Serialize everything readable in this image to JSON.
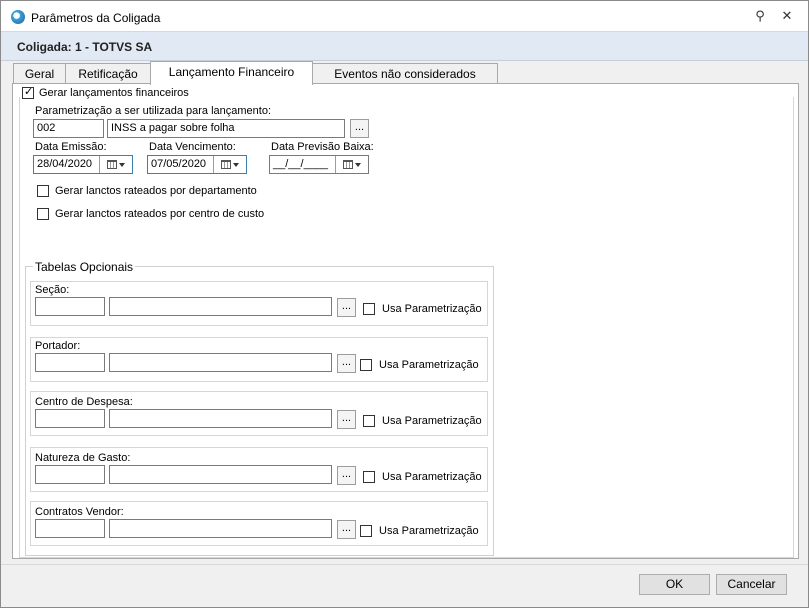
{
  "window": {
    "title": "Parâmetros da Coligada"
  },
  "header": {
    "context": "Coligada: 1 - TOTVS SA"
  },
  "tabs": [
    {
      "label": "Geral"
    },
    {
      "label": "Retificação"
    },
    {
      "label": "Lançamento Financeiro"
    },
    {
      "label": "Eventos não considerados"
    }
  ],
  "main": {
    "gerar_lancamentos": {
      "label": "Gerar lançamentos financeiros",
      "checked": true
    },
    "parametrizacao": {
      "label": "Parametrização a ser utilizada para lançamento:",
      "code": "002",
      "description": "INSS a pagar sobre folha",
      "lookup": "..."
    },
    "data_emissao": {
      "label": "Data Emissão:",
      "value": "28/04/2020"
    },
    "data_vencimento": {
      "label": "Data Vencimento:",
      "value": "07/05/2020"
    },
    "data_previsao": {
      "label": "Data Previsão Baixa:",
      "value": "__/__/____"
    },
    "rateio_departamento": {
      "label": "Gerar lanctos rateados por departamento",
      "checked": false
    },
    "rateio_centro_custo": {
      "label": "Gerar lanctos rateados por centro de custo",
      "checked": false
    }
  },
  "tabelas": {
    "title": "Tabelas Opcionais",
    "usa_label": "Usa Parametrização",
    "lookup": "...",
    "items": [
      {
        "label": "Seção:"
      },
      {
        "label": "Portador:"
      },
      {
        "label": "Centro de Despesa:"
      },
      {
        "label": "Natureza de Gasto:"
      },
      {
        "label": "Contratos Vendor:"
      }
    ]
  },
  "footer": {
    "ok": "OK",
    "cancel": "Cancelar"
  }
}
